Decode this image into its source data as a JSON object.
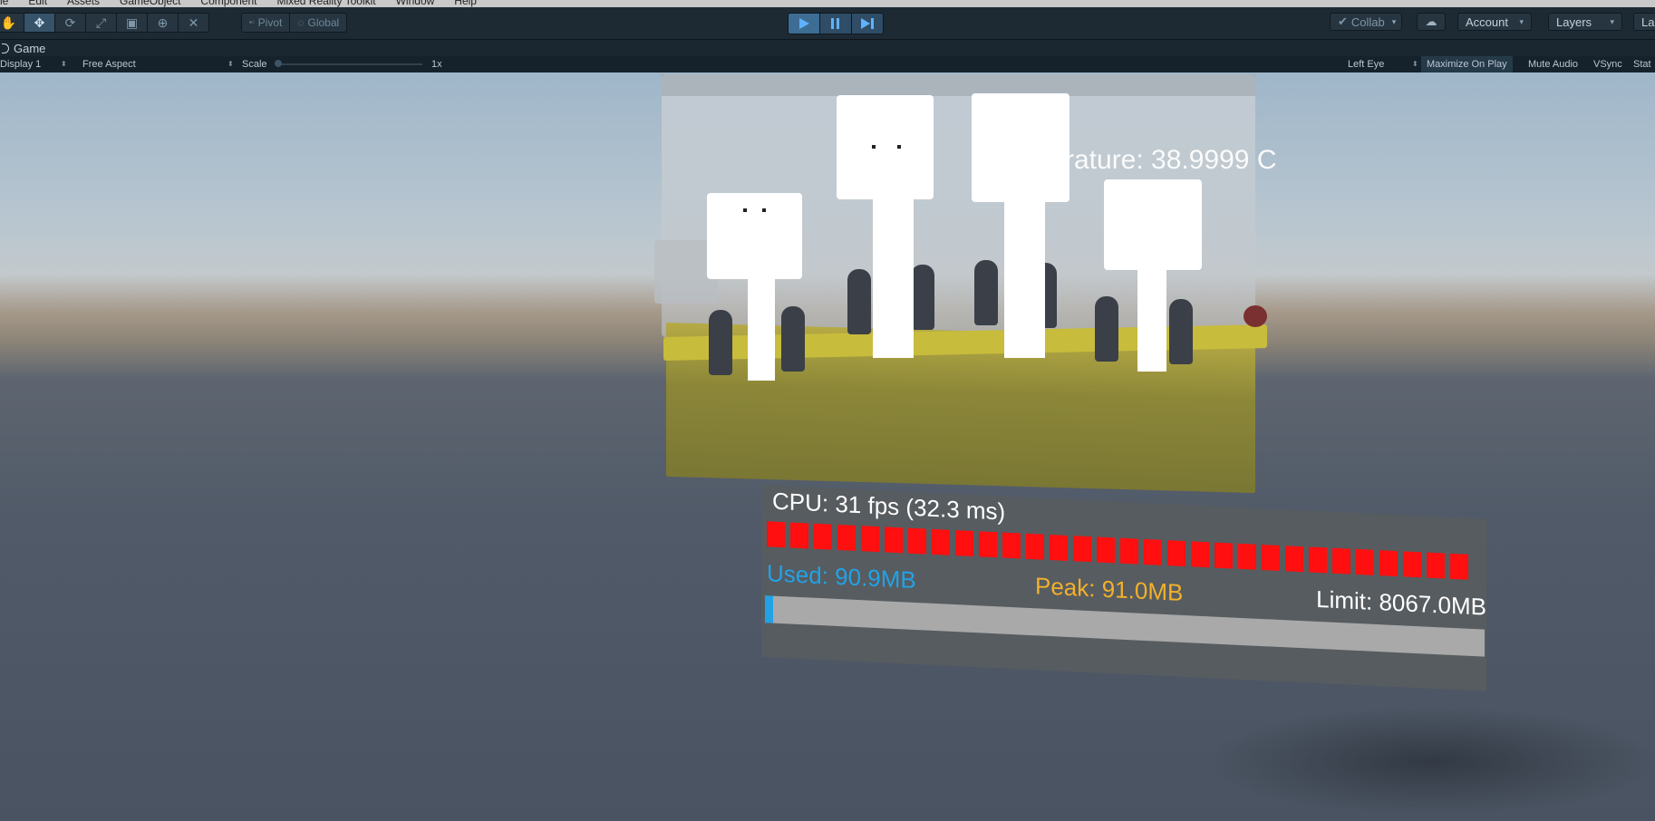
{
  "menubar": {
    "items": [
      "le",
      "Edit",
      "Assets",
      "GameObject",
      "Component",
      "Mixed Reality Toolkit",
      "Window",
      "Help"
    ]
  },
  "toolbar": {
    "tools": [
      "hand-tool",
      "move-tool",
      "rotate-tool",
      "scale-tool",
      "rect-tool",
      "transform-tool",
      "custom-tool"
    ],
    "active_tool": "move-tool",
    "pivot_label": "Pivot",
    "global_label": "Global",
    "collab_label": "Collab",
    "account_label": "Account",
    "layers_label": "Layers",
    "layout_label": "La"
  },
  "tab": {
    "label": "Game"
  },
  "gamebar": {
    "display": "Display 1",
    "aspect": "Free Aspect",
    "scale_label": "Scale",
    "scale_value": "1x",
    "eye": "Left Eye",
    "maximize": "Maximize On Play",
    "mute": "Mute Audio",
    "vsync": "VSync",
    "stats": "Stat"
  },
  "scene": {
    "temperature_text": "rature:  38.9999 C"
  },
  "diagnostics": {
    "cpu_text": "CPU: 31 fps (32.3 ms)",
    "fps_bar_count": 30,
    "used_text": "Used: 90.9MB",
    "peak_text": "Peak: 91.0MB",
    "limit_text": "Limit: 8067.0MB",
    "used_fraction": 0.011,
    "colors": {
      "fps_bar": "#ff0f0f",
      "used": "#22a2e6",
      "peak": "#f2b12a"
    }
  }
}
